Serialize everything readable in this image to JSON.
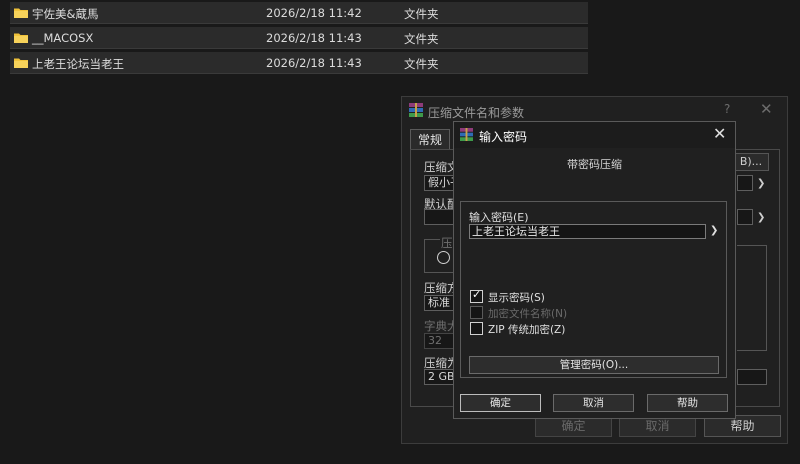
{
  "files": [
    {
      "name": "宇佐美&蔵馬",
      "date": "2026/2/18 11:42",
      "type": "文件夹"
    },
    {
      "name": "__MACOSX",
      "date": "2026/2/18 11:43",
      "type": "文件夹"
    },
    {
      "name": "上老王论坛当老王",
      "date": "2026/2/18 11:43",
      "type": "文件夹"
    }
  ],
  "archive_dialog": {
    "title": "压缩文件名和参数",
    "help": "?",
    "close": "✕",
    "tab_general": "常规",
    "label_archive_name": "压缩文",
    "archive_name_value": "假小子",
    "browse_button": "B)...",
    "label_default": "默认配",
    "label_archive_format": "压缩",
    "label_method": "压缩方",
    "method_value": "标准",
    "label_dictionary": "字典大",
    "dictionary_value": "32",
    "label_split": "压缩为",
    "split_value": "2 GB",
    "ok_button": "确定",
    "cancel_button": "取消",
    "help_button": "帮助"
  },
  "password_dialog": {
    "title": "输入密码",
    "close": "✕",
    "subtitle": "带密码压缩",
    "password_label": "输入密码(E)",
    "password_value": "上老王论坛当老王",
    "show_password": {
      "label": "显示密码(S)",
      "checked": true
    },
    "encrypt_names": {
      "label": "加密文件名称(N)",
      "checked": false
    },
    "zip_legacy": {
      "label": "ZIP 传统加密(Z)",
      "checked": false
    },
    "manage_button": "管理密码(O)...",
    "ok_button": "确定",
    "cancel_button": "取消",
    "help_button": "帮助"
  },
  "colors": {
    "background": "#191919",
    "folder_yellow": "#f0c23a",
    "dialog_bg": "#202020"
  }
}
